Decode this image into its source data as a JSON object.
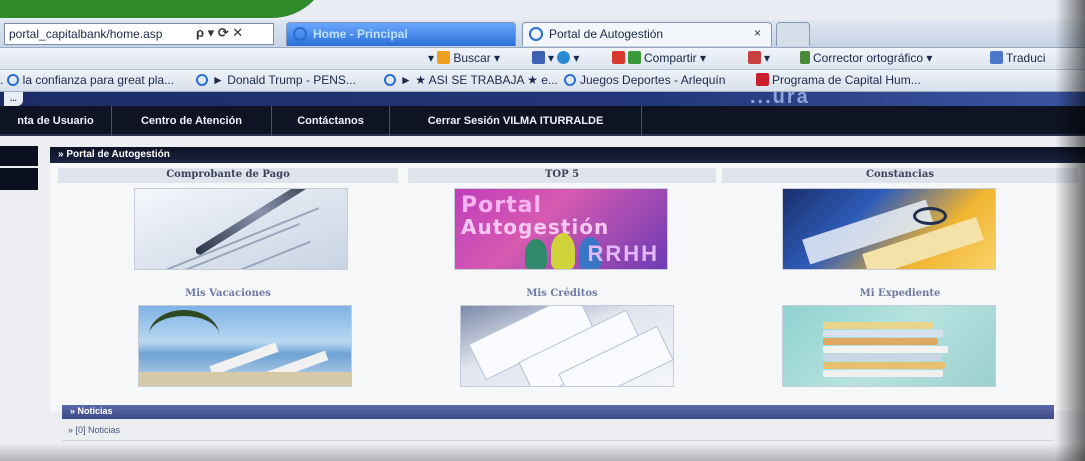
{
  "browser": {
    "address": "portal_capitalbank/home.asp",
    "address_tools": "ρ ▾ ⟳ ✕",
    "tabs": [
      {
        "label": "Home - Principal"
      },
      {
        "label": "Portal de Autogestión"
      }
    ],
    "tab_close": "×",
    "toolbar": {
      "buscar": "Buscar",
      "compartir": "Compartir",
      "corrector": "Corrector ortográfico",
      "traducir": "Traduci"
    },
    "favorites": [
      "la confianza para great pla...",
      "► Donald Trump - PENS...",
      "► ★ ASI SE TRABAJA ★ e...",
      "Juegos Deportes - Arlequín",
      "Programa de Capital Hum..."
    ]
  },
  "site": {
    "tag": "...",
    "brand": "...ura"
  },
  "nav": {
    "items": [
      "nta de Usuario",
      "Centro de Atención",
      "Contáctanos",
      "Cerrar Sesión VILMA ITURRALDE"
    ]
  },
  "portal": {
    "title": "» Portal de Autogestión",
    "cells": [
      {
        "label": "Comprobante de Pago",
        "icon": "receipt-pen-image"
      },
      {
        "label": "TOP 5",
        "icon": "portal-autogestion-rrhh-image"
      },
      {
        "label": "Constancias",
        "icon": "documents-glasses-image"
      },
      {
        "label": "Mis Vacaciones",
        "icon": "beach-chairs-image"
      },
      {
        "label": "Mis Créditos",
        "icon": "credit-documents-image"
      },
      {
        "label": "Mi Expediente",
        "icon": "folder-stack-image"
      }
    ],
    "top5_image_text": {
      "line1": "Portal",
      "line2": "Autogestión",
      "line3": "RRHH"
    }
  },
  "news": {
    "title": "» Noticias",
    "item": "» [0] Noticias"
  },
  "colors": {
    "nav_bg": "#0e1424",
    "panel_title_bg": "#0d1224",
    "news_bar": "#4a5996",
    "tab_active": "#2b6fd6"
  }
}
